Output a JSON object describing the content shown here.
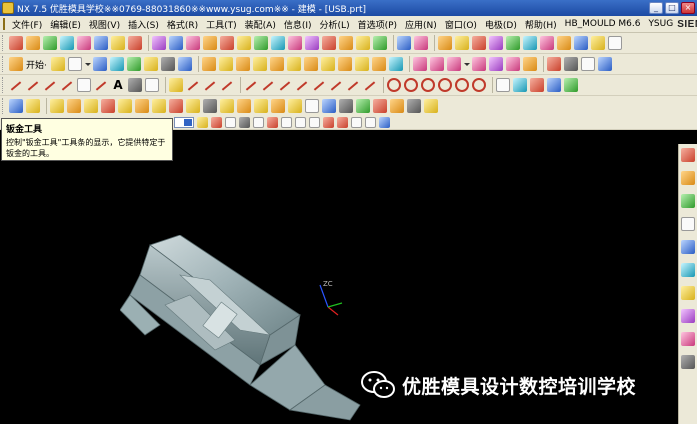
{
  "window": {
    "title": "NX 7.5 优胜模具学校※※0769-88031860※※www.ysug.com※※ - 建模 - [USB.prt]",
    "brand": "SIEMENS"
  },
  "menu": {
    "items": [
      "文件(F)",
      "编辑(E)",
      "视图(V)",
      "插入(S)",
      "格式(R)",
      "工具(T)",
      "装配(A)",
      "信息(I)",
      "分析(L)",
      "首选项(P)",
      "应用(N)",
      "窗口(O)",
      "电极(D)",
      "帮助(H)",
      "HB_MOULD M6.6",
      "YSUG"
    ]
  },
  "toolbar": {
    "start_label": "开始·"
  },
  "tooltip": {
    "title": "钣金工具",
    "body": "控制\"钣金工具\"工具条的显示，它提供特定于钣金的工具。"
  },
  "graphics": {
    "triad_label": "ZC"
  },
  "watermark": {
    "text": "优胜模具设计数控培训学校"
  },
  "colors": {
    "titlebar": "#1c4aa3",
    "menubar": "#ece9d8",
    "graphics_bg": "#000000",
    "part_fill": "#9fb2b6"
  },
  "icons": {
    "app": "nx-app-icon",
    "minimize": "minimize-icon",
    "maximize": "maximize-icon",
    "close": "close-icon",
    "watermark": "wechat-icon"
  }
}
